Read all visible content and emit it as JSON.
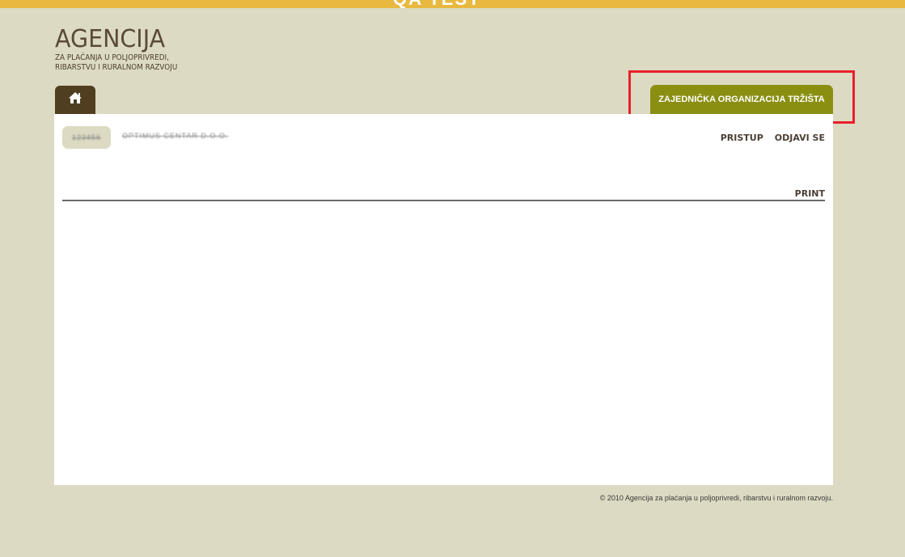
{
  "topbar": {
    "text": "QA TEST"
  },
  "logo": {
    "title": "AGENCIJA",
    "subtitle_line1": "ZA PLAĆANJA U POLJOPRIVREDI,",
    "subtitle_line2": "RIBARSTVU I RURALNOM RAZVOJU"
  },
  "nav": {
    "home_icon": "home-icon",
    "tab_label": "ZAJEDNIČKA ORGANIZACIJA TRŽIŠTA"
  },
  "user": {
    "id": "123456",
    "name": "OPTIMUS CENTAR D.O.O."
  },
  "header_links": {
    "access": "PRISTUP",
    "logout": "ODJAVI SE"
  },
  "print_label": "PRINT",
  "footer": {
    "text": "© 2010 Agencija za plaćanja u poljoprivredi, ribarstvu i ruralnom razvoju."
  },
  "colors": {
    "background": "#dcdac2",
    "topbar": "#e9b93f",
    "home_tab": "#4f3e1f",
    "nav_tab": "#8a8f12",
    "highlight": "#e8202a"
  }
}
